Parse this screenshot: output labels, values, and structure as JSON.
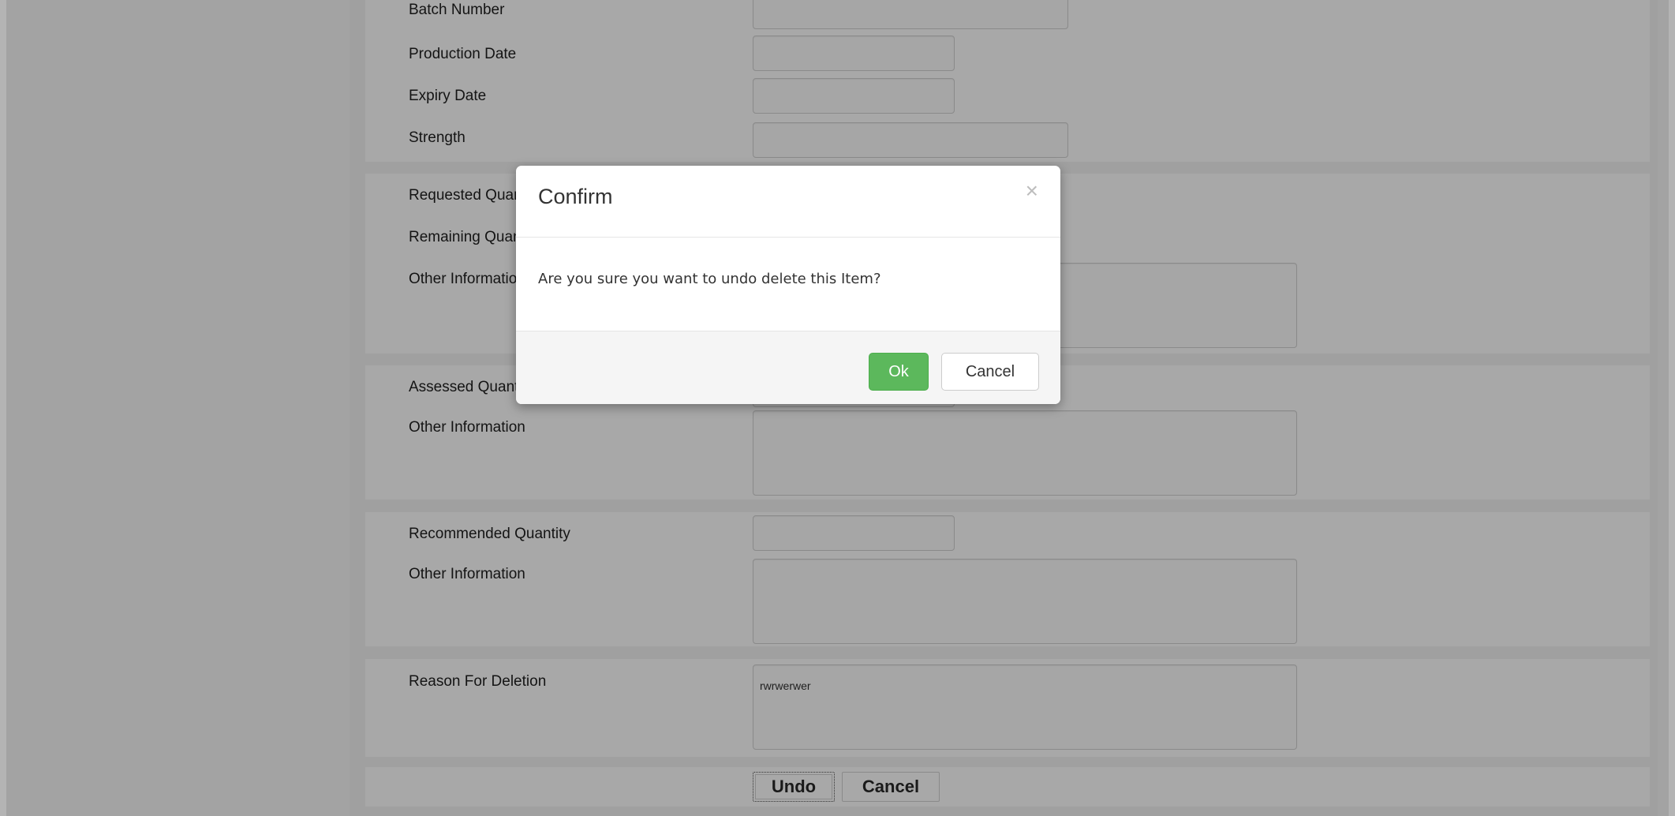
{
  "form": {
    "section1": {
      "batch_number_label": "Batch Number",
      "production_date_label": "Production Date",
      "expiry_date_label": "Expiry Date",
      "strength_label": "Strength"
    },
    "section2": {
      "requested_quantity_label": "Requested Quantity",
      "remaining_quantity_label": "Remaining Quantity",
      "other_information_label": "Other Information"
    },
    "section3": {
      "assessed_quantity_label": "Assessed Quantity",
      "other_information_label": "Other Information"
    },
    "section4": {
      "recommended_quantity_label": "Recommended Quantity",
      "other_information_label": "Other Information"
    },
    "section5": {
      "reason_for_deletion_label": "Reason For Deletion",
      "reason_for_deletion_value": "rwrwerwer"
    },
    "actions": {
      "undo_label": "Undo",
      "cancel_label": "Cancel"
    }
  },
  "modal": {
    "title": "Confirm",
    "close_glyph": "×",
    "message": "Are you sure you want to undo delete this Item?",
    "ok_label": "Ok",
    "cancel_label": "Cancel"
  }
}
